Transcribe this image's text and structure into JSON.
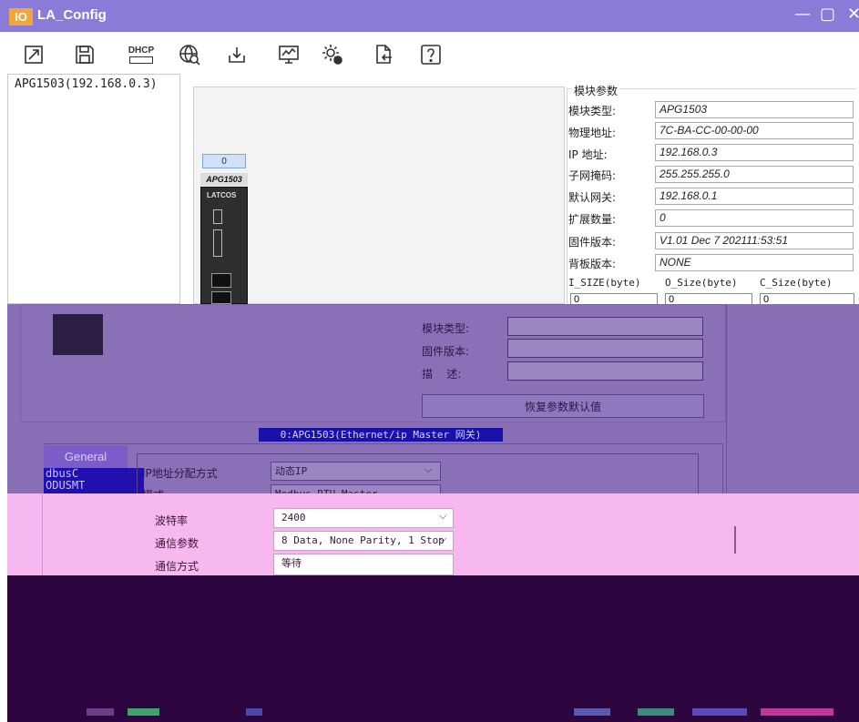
{
  "window": {
    "logo": "IO",
    "title": "LA_Config",
    "minimize": "—",
    "maximize": "▢",
    "close": "✕"
  },
  "toolbar": {
    "dhcp_label": "DHCP"
  },
  "tree": {
    "items": [
      "APG1503(192.168.0.3)"
    ]
  },
  "diagram": {
    "slot_number": "0",
    "device_name": "APG1503",
    "brand": "LATCOS"
  },
  "params": {
    "group_title": "模块参数",
    "rows": [
      {
        "label": "模块类型:",
        "value": "APG1503"
      },
      {
        "label": "物理地址:",
        "value": "7C-BA-CC-00-00-00"
      },
      {
        "label": "IP 地址:",
        "value": "192.168.0.3"
      },
      {
        "label": "子网掩码:",
        "value": "255.255.255.0"
      },
      {
        "label": "默认网关:",
        "value": "192.168.0.1"
      },
      {
        "label": "扩展数量:",
        "value": "0"
      },
      {
        "label": "固件版本:",
        "value": "V1.01 Dec 7 202111:53:51"
      },
      {
        "label": "背板版本:",
        "value": "NONE"
      }
    ],
    "size_headers": [
      "I_SIZE(byte)",
      "O_Size(byte)",
      "C_Size(byte)"
    ],
    "size_values": [
      "0",
      "0",
      "0"
    ]
  },
  "submodule": {
    "labels": [
      "模块类型:",
      "固件版本:",
      "描    述:"
    ],
    "restore_button": "恢复参数默认值"
  },
  "module_bar": "0:APG1503(Ethernet/ip Master 网关)",
  "tabs": {
    "general": "General",
    "modbus": "dbusC",
    "modbus2": "ODUSMT"
  },
  "config": {
    "ip_label": "IP地址分配方式",
    "ip_value": "动态IP",
    "mode_label": "模式",
    "mode_value": "Modbus RTU Master",
    "baud_label": "波特率",
    "baud_value": "2400",
    "comm_label": "通信参数",
    "comm_value": "8 Data, None Parity, 1 Stop",
    "method_label": "通信方式",
    "method_value": "等待"
  }
}
